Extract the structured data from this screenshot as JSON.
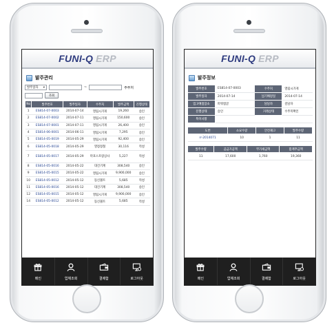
{
  "app": {
    "logo_main": "FUNI-Q",
    "logo_sub": "ERP"
  },
  "nav": [
    {
      "label": "메인",
      "icon": "gift-icon"
    },
    {
      "label": "업체조회",
      "icon": "user-icon"
    },
    {
      "label": "결제함",
      "icon": "wallet-icon"
    },
    {
      "label": "로그아웃",
      "icon": "logout-icon"
    }
  ],
  "left": {
    "title": "발주관리",
    "filter": {
      "select_value": "발주일자",
      "separator": "~",
      "suffix": "주주처",
      "search_button": "조회"
    },
    "columns": [
      "No",
      "발주번호",
      "발주일자",
      "수주처",
      "발주금액",
      "진행상태"
    ],
    "rows": [
      [
        "1",
        "ES814-07-0003",
        "2014-07-14",
        "영림시가게",
        "19,260",
        "승인"
      ],
      [
        "2",
        "ES814-07-0002",
        "2014-07-11",
        "영림시가게",
        "150,600",
        "승인"
      ],
      [
        "3",
        "ES814-07-0001",
        "2014-07-11",
        "영림시가게",
        "26,400",
        "승인"
      ],
      [
        "4",
        "ES814-06-0001",
        "2014-06-11",
        "영림시가게",
        "7,295",
        "승인"
      ],
      [
        "5",
        "ES814-05-0019",
        "2014-05-29",
        "영림시가게",
        "92,400",
        "승인"
      ],
      [
        "6",
        "ES814-05-0018",
        "2014-05-29",
        "영정정철",
        "30,116",
        "작성"
      ],
      [
        "7",
        "ES814-05-0017",
        "2014-05-29",
        "마포스프랑상사",
        "5,227",
        "작성"
      ],
      [
        "8",
        "ES814-05-0016",
        "2014-05-22",
        "대건기계",
        "308,540",
        "승인"
      ],
      [
        "9",
        "ES814-05-0015",
        "2014-05-22",
        "영림시가게",
        "9,900,000",
        "승인"
      ],
      [
        "10",
        "ES814-05-0012",
        "2014-05-12",
        "동신볼트",
        "5,685",
        "작성"
      ],
      [
        "11",
        "ES814-05-0016",
        "2014-05-12",
        "대건기계",
        "308,540",
        "승인"
      ],
      [
        "12",
        "ES814-05-0015",
        "2014-05-12",
        "영림시가게",
        "9,900,000",
        "승인"
      ],
      [
        "14",
        "ES814-05-0012",
        "2014-05-12",
        "동신볼트",
        "5,685",
        "작성"
      ]
    ]
  },
  "right": {
    "title": "발주정보",
    "info": [
      [
        "발주번호",
        "ES814-07-0003",
        "수주처",
        "영림시가게"
      ],
      [
        "발주일자",
        "2014-07-14",
        "납기예정일",
        "2014-07-14"
      ],
      [
        "입고예정장소",
        "파워앵글",
        "담당자",
        "김담자"
      ],
      [
        "진행상태",
        "승인",
        "거래상태",
        "수주미확인"
      ],
      [
        "특이사항",
        "",
        "",
        ""
      ]
    ],
    "item_columns": [
      "도번",
      "소요수량",
      "안전재고",
      "발주수량"
    ],
    "item_rows": [
      [
        "rr-2014071",
        "10",
        "1",
        "11"
      ]
    ],
    "sum_columns": [
      "발주수량",
      "공급가공액",
      "부가세금액",
      "합계주금액"
    ],
    "sum_rows": [
      [
        "11",
        "17,600",
        "1,760",
        "19,360"
      ]
    ]
  }
}
